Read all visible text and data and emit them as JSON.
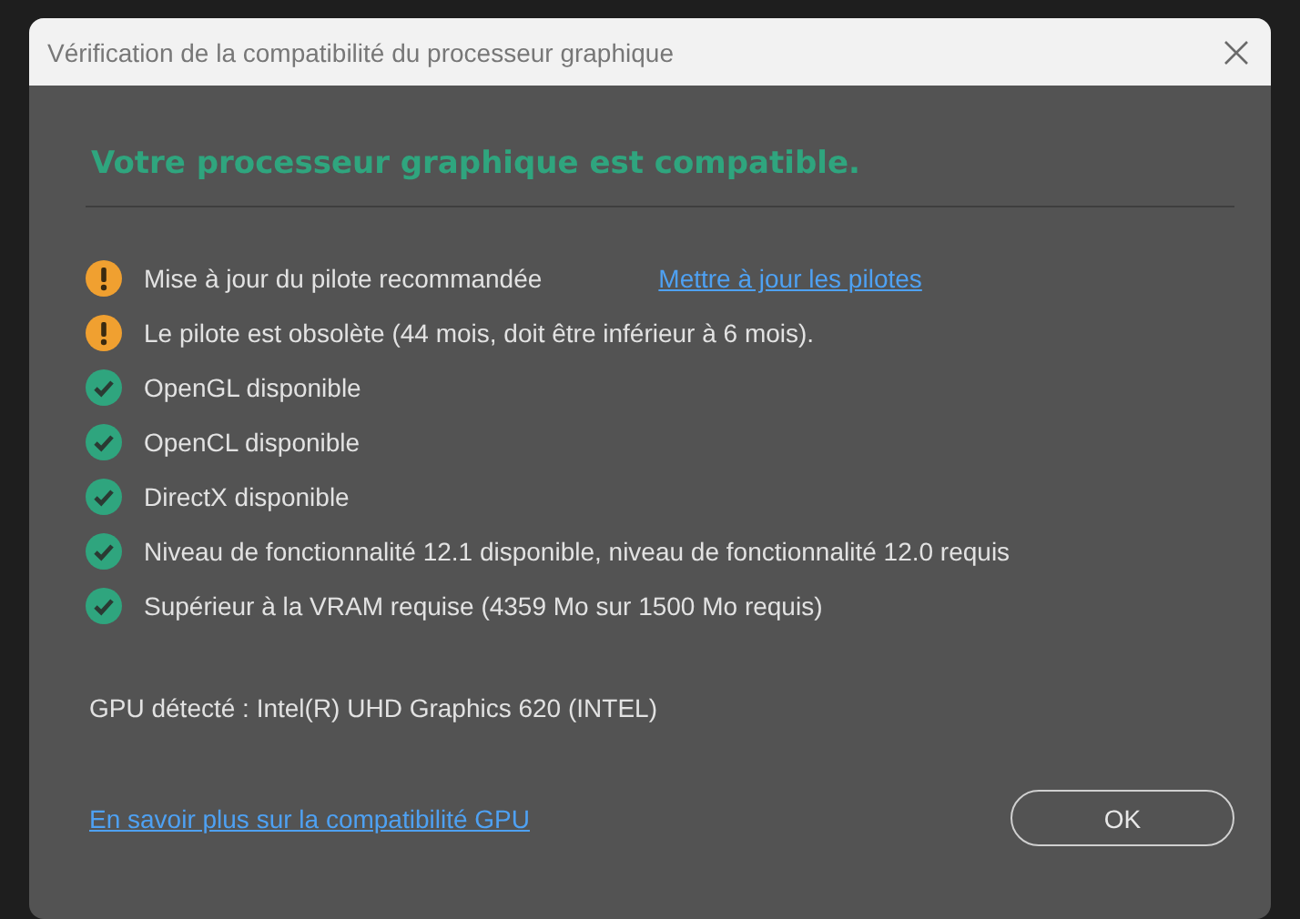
{
  "window": {
    "title": "Vérification de la compatibilité du processeur graphique"
  },
  "heading": "Votre processeur graphique est compatible.",
  "checks": [
    {
      "kind": "warning",
      "text": "Mise à jour du pilote recommandée",
      "link": "Mettre à jour les pilotes"
    },
    {
      "kind": "warning",
      "text": "Le pilote est obsolète (44 mois, doit être inférieur à 6 mois)."
    },
    {
      "kind": "ok",
      "text": "OpenGL disponible"
    },
    {
      "kind": "ok",
      "text": "OpenCL disponible"
    },
    {
      "kind": "ok",
      "text": "DirectX disponible"
    },
    {
      "kind": "ok",
      "text": "Niveau de fonctionnalité 12.1 disponible, niveau de fonctionnalité 12.0 requis"
    },
    {
      "kind": "ok",
      "text": "Supérieur à la VRAM requise (4359 Mo sur 1500 Mo requis)"
    }
  ],
  "gpu": "GPU détecté : Intel(R) UHD Graphics 620 (INTEL)",
  "footer_link": "En savoir plus sur la compatibilité GPU",
  "buttons": [
    "OK"
  ]
}
